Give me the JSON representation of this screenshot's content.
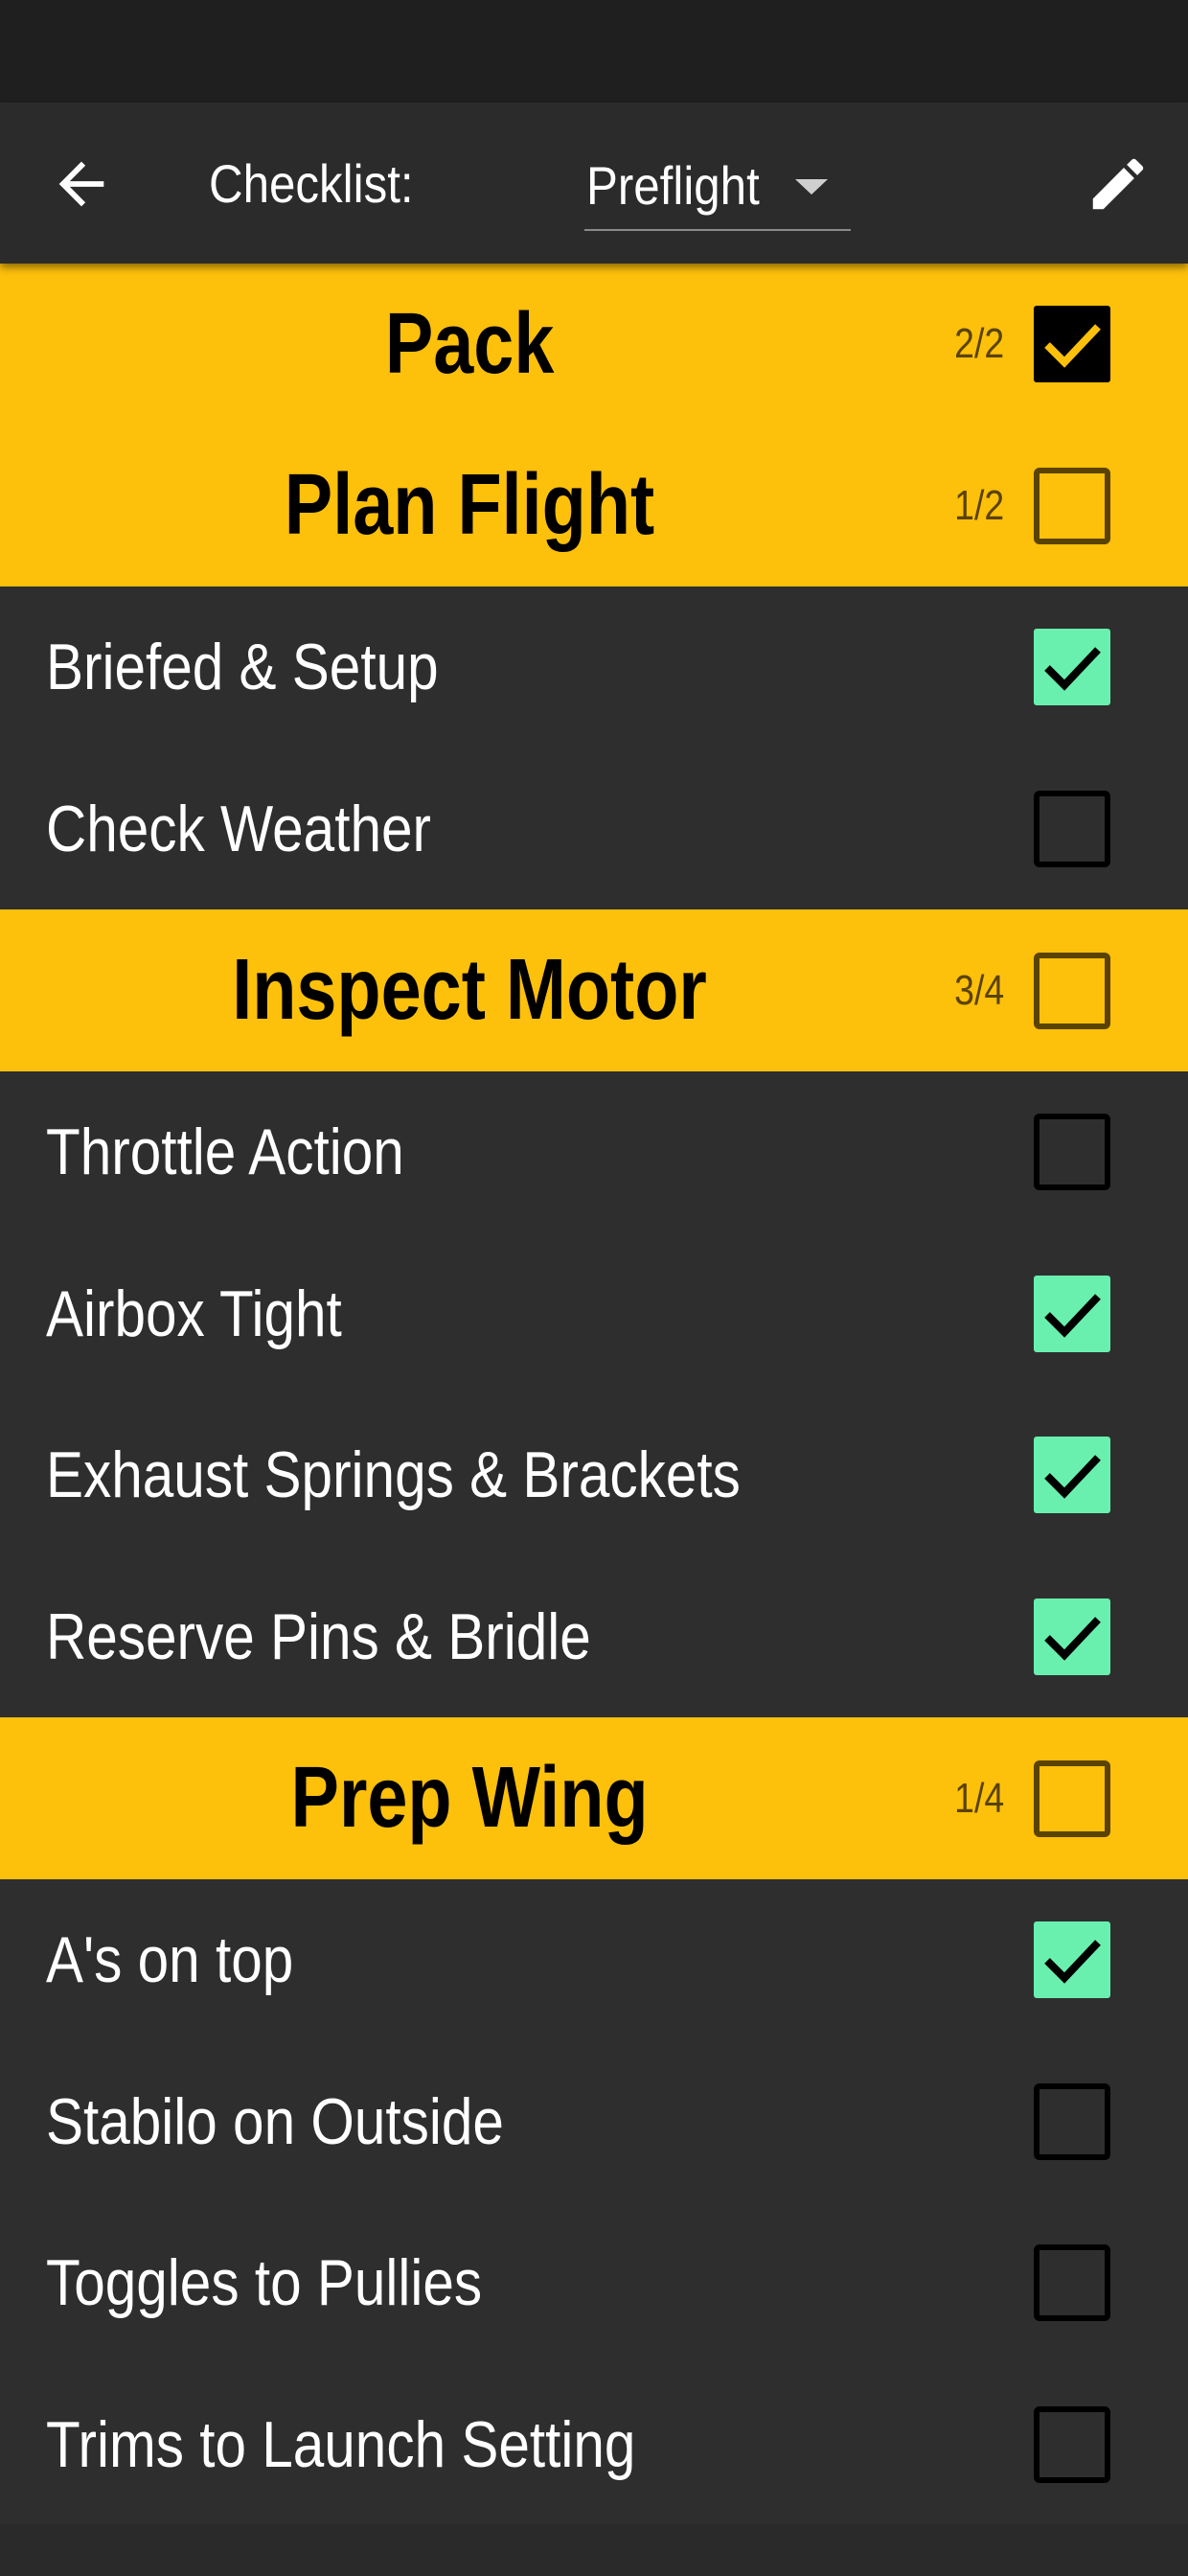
{
  "appbar": {
    "title_label": "Checklist:",
    "selected_checklist": "Preflight",
    "back_icon": "arrow-left-icon",
    "edit_icon": "pencil-icon"
  },
  "colors": {
    "section_bg": "#fdc00b",
    "item_bg": "#2e2e2f",
    "check_green": "#69f0ae",
    "appbar_bg": "#2b2b2c"
  },
  "rows": [
    {
      "type": "section",
      "title": "Pack",
      "progress": "2/2",
      "checked": true
    },
    {
      "type": "section",
      "title": "Plan Flight",
      "progress": "1/2",
      "checked": false
    },
    {
      "type": "item",
      "label": "Briefed & Setup",
      "checked": true
    },
    {
      "type": "item",
      "label": "Check Weather",
      "checked": false
    },
    {
      "type": "section",
      "title": "Inspect Motor",
      "progress": "3/4",
      "checked": false
    },
    {
      "type": "item",
      "label": "Throttle Action",
      "checked": false
    },
    {
      "type": "item",
      "label": "Airbox Tight",
      "checked": true
    },
    {
      "type": "item",
      "label": "Exhaust Springs & Brackets",
      "checked": true
    },
    {
      "type": "item",
      "label": "Reserve Pins & Bridle",
      "checked": true
    },
    {
      "type": "section",
      "title": "Prep Wing",
      "progress": "1/4",
      "checked": false
    },
    {
      "type": "item",
      "label": "A's on top",
      "checked": true
    },
    {
      "type": "item",
      "label": "Stabilo on Outside",
      "checked": false
    },
    {
      "type": "item",
      "label": "Toggles to Pullies",
      "checked": false
    },
    {
      "type": "item",
      "label": "Trims to Launch Setting",
      "checked": false
    }
  ]
}
